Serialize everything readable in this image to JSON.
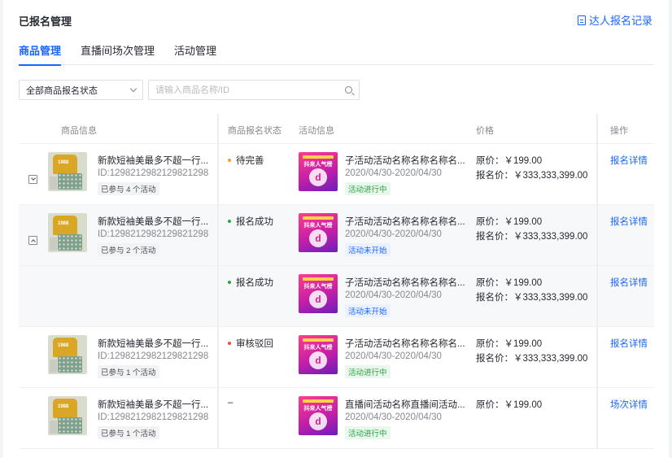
{
  "header": {
    "title": "已报名管理",
    "records_link": "达人报名记录"
  },
  "tabs": [
    "商品管理",
    "直播间场次管理",
    "活动管理"
  ],
  "filters": {
    "status_select": "全部商品报名状态",
    "search_placeholder": "请输入商品名称/ID"
  },
  "table": {
    "columns": [
      "商品信息",
      "商品报名状态",
      "活动信息",
      "价格",
      "操作"
    ],
    "rows": [
      {
        "toggle": "collapsed",
        "product": {
          "name": "新款短袖美最多不超一行...",
          "id": "ID:1298212982129821298",
          "tag": "已参与 4 个活动"
        },
        "status": {
          "label": "待完善",
          "color": "#ff9a2e"
        },
        "activity": {
          "banner_title": "抖来人气榜",
          "banner_logo": "d",
          "name": "子活动活动名称名称名称名...",
          "date": "2020/04/30-2020/04/30",
          "tag": "活动进行中",
          "tag_type": "green"
        },
        "price": {
          "original": "原价：￥199.00",
          "signup": "报名价：￥333,333,399.00"
        },
        "action": "报名详情"
      },
      {
        "toggle": "expanded",
        "product": {
          "name": "新款短袖美最多不超一行...",
          "id": "ID:1298212982129821298",
          "tag": "已参与 2 个活动"
        },
        "status": {
          "label": "报名成功",
          "color": "#2ba445"
        },
        "activity": {
          "banner_title": "抖来人气榜",
          "banner_logo": "d",
          "name": "子活动活动名称名称名称名...",
          "date": "2020/04/30-2020/04/30",
          "tag": "活动未开始",
          "tag_type": "blue"
        },
        "price": {
          "original": "原价：￥199.00",
          "signup": "报名价：￥333,333,399.00"
        },
        "action": "报名详情"
      },
      {
        "toggle": "none",
        "product": null,
        "status": {
          "label": "报名成功",
          "color": "#2ba445"
        },
        "activity": {
          "banner_title": "抖来人气榜",
          "banner_logo": "d",
          "name": "子活动活动名称名称名称名...",
          "date": "2020/04/30-2020/04/30",
          "tag": "活动未开始",
          "tag_type": "blue"
        },
        "price": {
          "original": "原价：￥199.00",
          "signup": "报名价：￥333,333,399.00"
        },
        "action": "报名详情"
      },
      {
        "toggle": "none",
        "product": {
          "name": "新款短袖美最多不超一行...",
          "id": "ID:1298212982129821298",
          "tag": "已参与 1 个活动"
        },
        "status": {
          "label": "审核驳回",
          "color": "#f54a45"
        },
        "activity": {
          "banner_title": "抖来人气榜",
          "banner_logo": "d",
          "name": "子活动活动名称名称名称名...",
          "date": "2020/04/30-2020/04/30",
          "tag": "活动进行中",
          "tag_type": "green"
        },
        "price": {
          "original": "原价：￥199.00",
          "signup": "报名价：￥333,333,399.00"
        },
        "action": "报名详情"
      },
      {
        "toggle": "none",
        "product": {
          "name": "新款短袖美最多不超一行...",
          "id": "ID:1298212982129821298",
          "tag": "已参与 1 个活动"
        },
        "status": {
          "label": "–",
          "color": ""
        },
        "activity": {
          "banner_title": "抖来人气榜",
          "banner_logo": "d",
          "name": "直播间活动名称直播间活动...",
          "date": "2020/04/30-2020/04/30",
          "tag": "活动进行中",
          "tag_type": "green"
        },
        "price": {
          "original": "原价：￥199.00",
          "signup": ""
        },
        "action": "场次详情"
      }
    ]
  },
  "thumb_text": "1988",
  "colors": {
    "accent": "#1966ff",
    "text": "#252931",
    "muted": "#85888e"
  }
}
